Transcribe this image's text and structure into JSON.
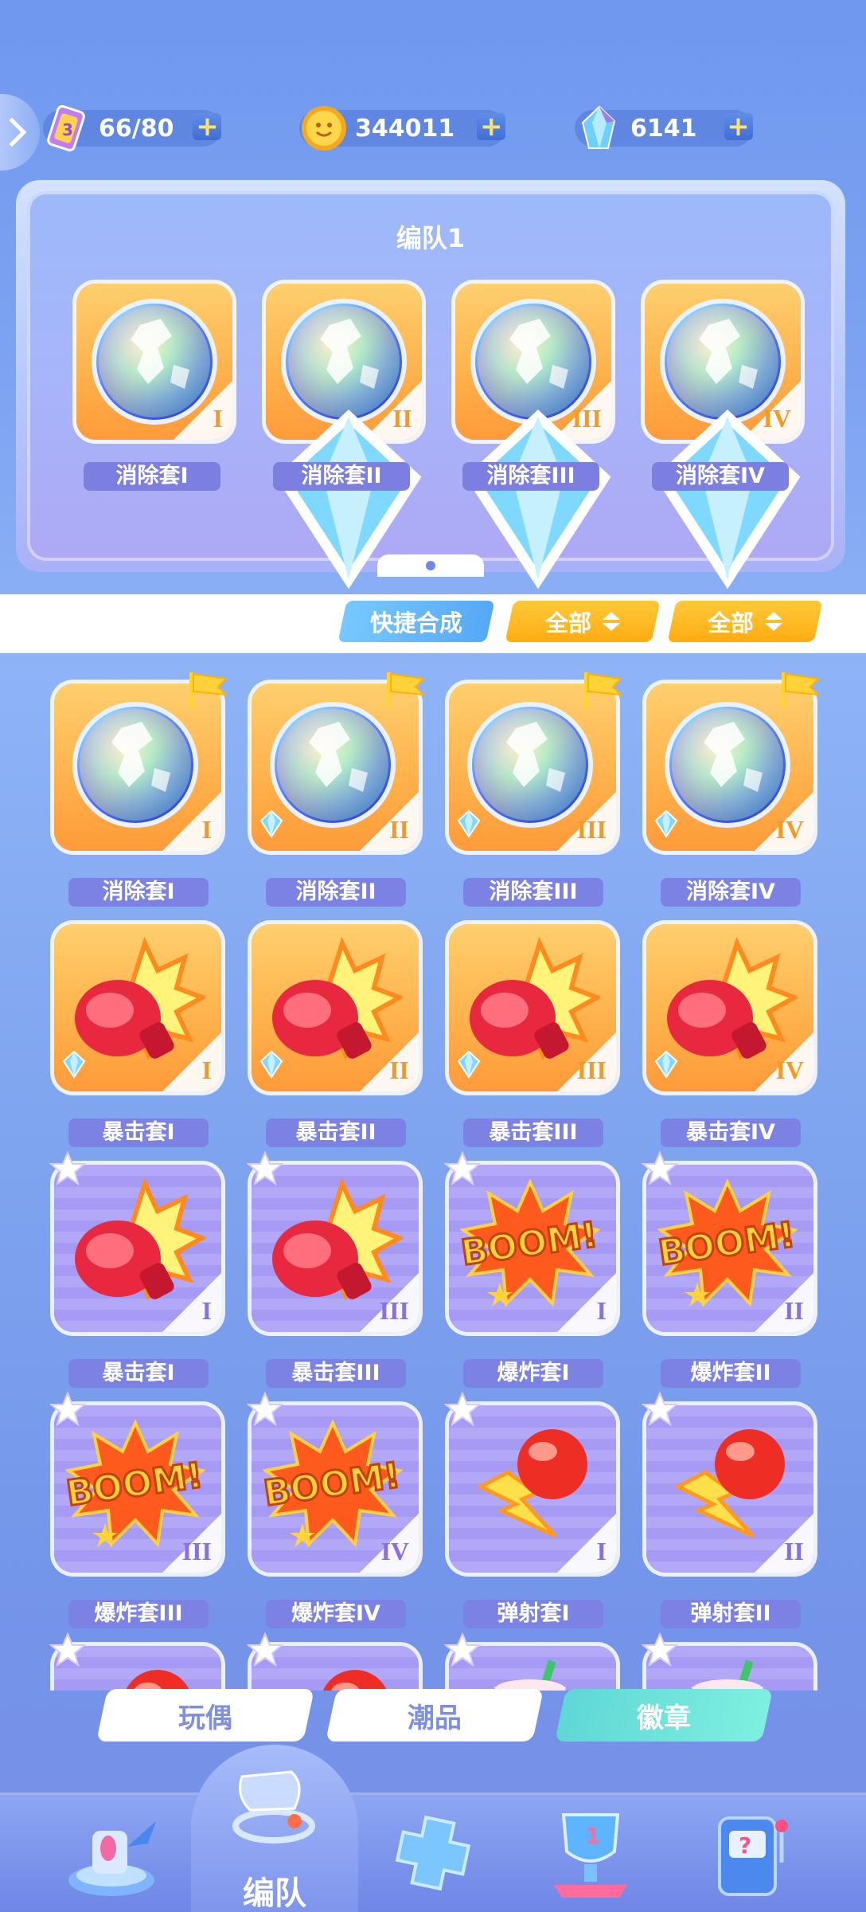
{
  "resources": {
    "stamina": {
      "value": "66/80",
      "icon": "stamina-card-icon"
    },
    "coins": {
      "value": "344011",
      "icon": "coin-icon"
    },
    "crystals": {
      "value": "6141",
      "icon": "crystal-icon"
    }
  },
  "team": {
    "title": "编队1",
    "slots": [
      {
        "name": "消除套I",
        "roman": "I"
      },
      {
        "name": "消除套II",
        "roman": "II"
      },
      {
        "name": "消除套III",
        "roman": "III"
      },
      {
        "name": "消除套IV",
        "roman": "IV"
      }
    ]
  },
  "filters": {
    "quick_merge": "快捷合成",
    "filter1": "全部",
    "filter2": "全部"
  },
  "items": [
    {
      "name": "消除套I",
      "roman": "I",
      "art": "globe",
      "bg": "orange",
      "gem": false,
      "badge": "flag"
    },
    {
      "name": "消除套II",
      "roman": "II",
      "art": "globe",
      "bg": "orange",
      "gem": true,
      "badge": "flag"
    },
    {
      "name": "消除套III",
      "roman": "III",
      "art": "globe",
      "bg": "orange",
      "gem": true,
      "badge": "flag"
    },
    {
      "name": "消除套IV",
      "roman": "IV",
      "art": "globe",
      "bg": "orange",
      "gem": true,
      "badge": "flag"
    },
    {
      "name": "暴击套I",
      "roman": "I",
      "art": "glove",
      "bg": "orange",
      "gem": true,
      "badge": "none"
    },
    {
      "name": "暴击套II",
      "roman": "II",
      "art": "glove",
      "bg": "orange",
      "gem": true,
      "badge": "none"
    },
    {
      "name": "暴击套III",
      "roman": "III",
      "art": "glove",
      "bg": "orange",
      "gem": true,
      "badge": "none"
    },
    {
      "name": "暴击套IV",
      "roman": "IV",
      "art": "glove",
      "bg": "orange",
      "gem": true,
      "badge": "none"
    },
    {
      "name": "暴击套I",
      "roman": "I",
      "art": "glove",
      "bg": "purple",
      "gem": false,
      "badge": "star"
    },
    {
      "name": "暴击套III",
      "roman": "III",
      "art": "glove",
      "bg": "purple",
      "gem": false,
      "badge": "star"
    },
    {
      "name": "爆炸套I",
      "roman": "I",
      "art": "boom",
      "bg": "purple",
      "gem": false,
      "badge": "star"
    },
    {
      "name": "爆炸套II",
      "roman": "II",
      "art": "boom",
      "bg": "purple",
      "gem": false,
      "badge": "star"
    },
    {
      "name": "爆炸套III",
      "roman": "III",
      "art": "boom",
      "bg": "purple",
      "gem": false,
      "badge": "star"
    },
    {
      "name": "爆炸套IV",
      "roman": "IV",
      "art": "boom",
      "bg": "purple",
      "gem": false,
      "badge": "star"
    },
    {
      "name": "弹射套I",
      "roman": "I",
      "art": "bolt",
      "bg": "purple",
      "gem": false,
      "badge": "star"
    },
    {
      "name": "弹射套II",
      "roman": "II",
      "art": "bolt",
      "bg": "purple",
      "gem": false,
      "badge": "star"
    },
    {
      "name": "",
      "roman": "",
      "art": "bolt",
      "bg": "purple",
      "gem": false,
      "badge": "star"
    },
    {
      "name": "",
      "roman": "",
      "art": "bolt",
      "bg": "purple",
      "gem": false,
      "badge": "star"
    },
    {
      "name": "",
      "roman": "",
      "art": "drink",
      "bg": "purple",
      "gem": false,
      "badge": "star"
    },
    {
      "name": "",
      "roman": "",
      "art": "drink",
      "bg": "purple",
      "gem": false,
      "badge": "star"
    }
  ],
  "category_tabs": [
    {
      "label": "玩偶",
      "active": false
    },
    {
      "label": "潮品",
      "active": false
    },
    {
      "label": "徽章",
      "active": true
    }
  ],
  "nav": {
    "active_label": "编队",
    "items": [
      "home-rocket-icon",
      "team-whistle-icon",
      "gamepad-icon",
      "trophy-icon",
      "slot-machine-icon"
    ]
  },
  "colors": {
    "accent_teal": "#5fd7d6",
    "accent_yellow": "#ffb81c",
    "label_purple": "#7b82e3"
  },
  "icons": {
    "add": "plus-icon",
    "side": "chevron-right-icon",
    "new_flag": "flag-icon",
    "favorite": "star-icon",
    "quality_gem": "diamond-icon",
    "sort": "sort-updown-icon"
  }
}
